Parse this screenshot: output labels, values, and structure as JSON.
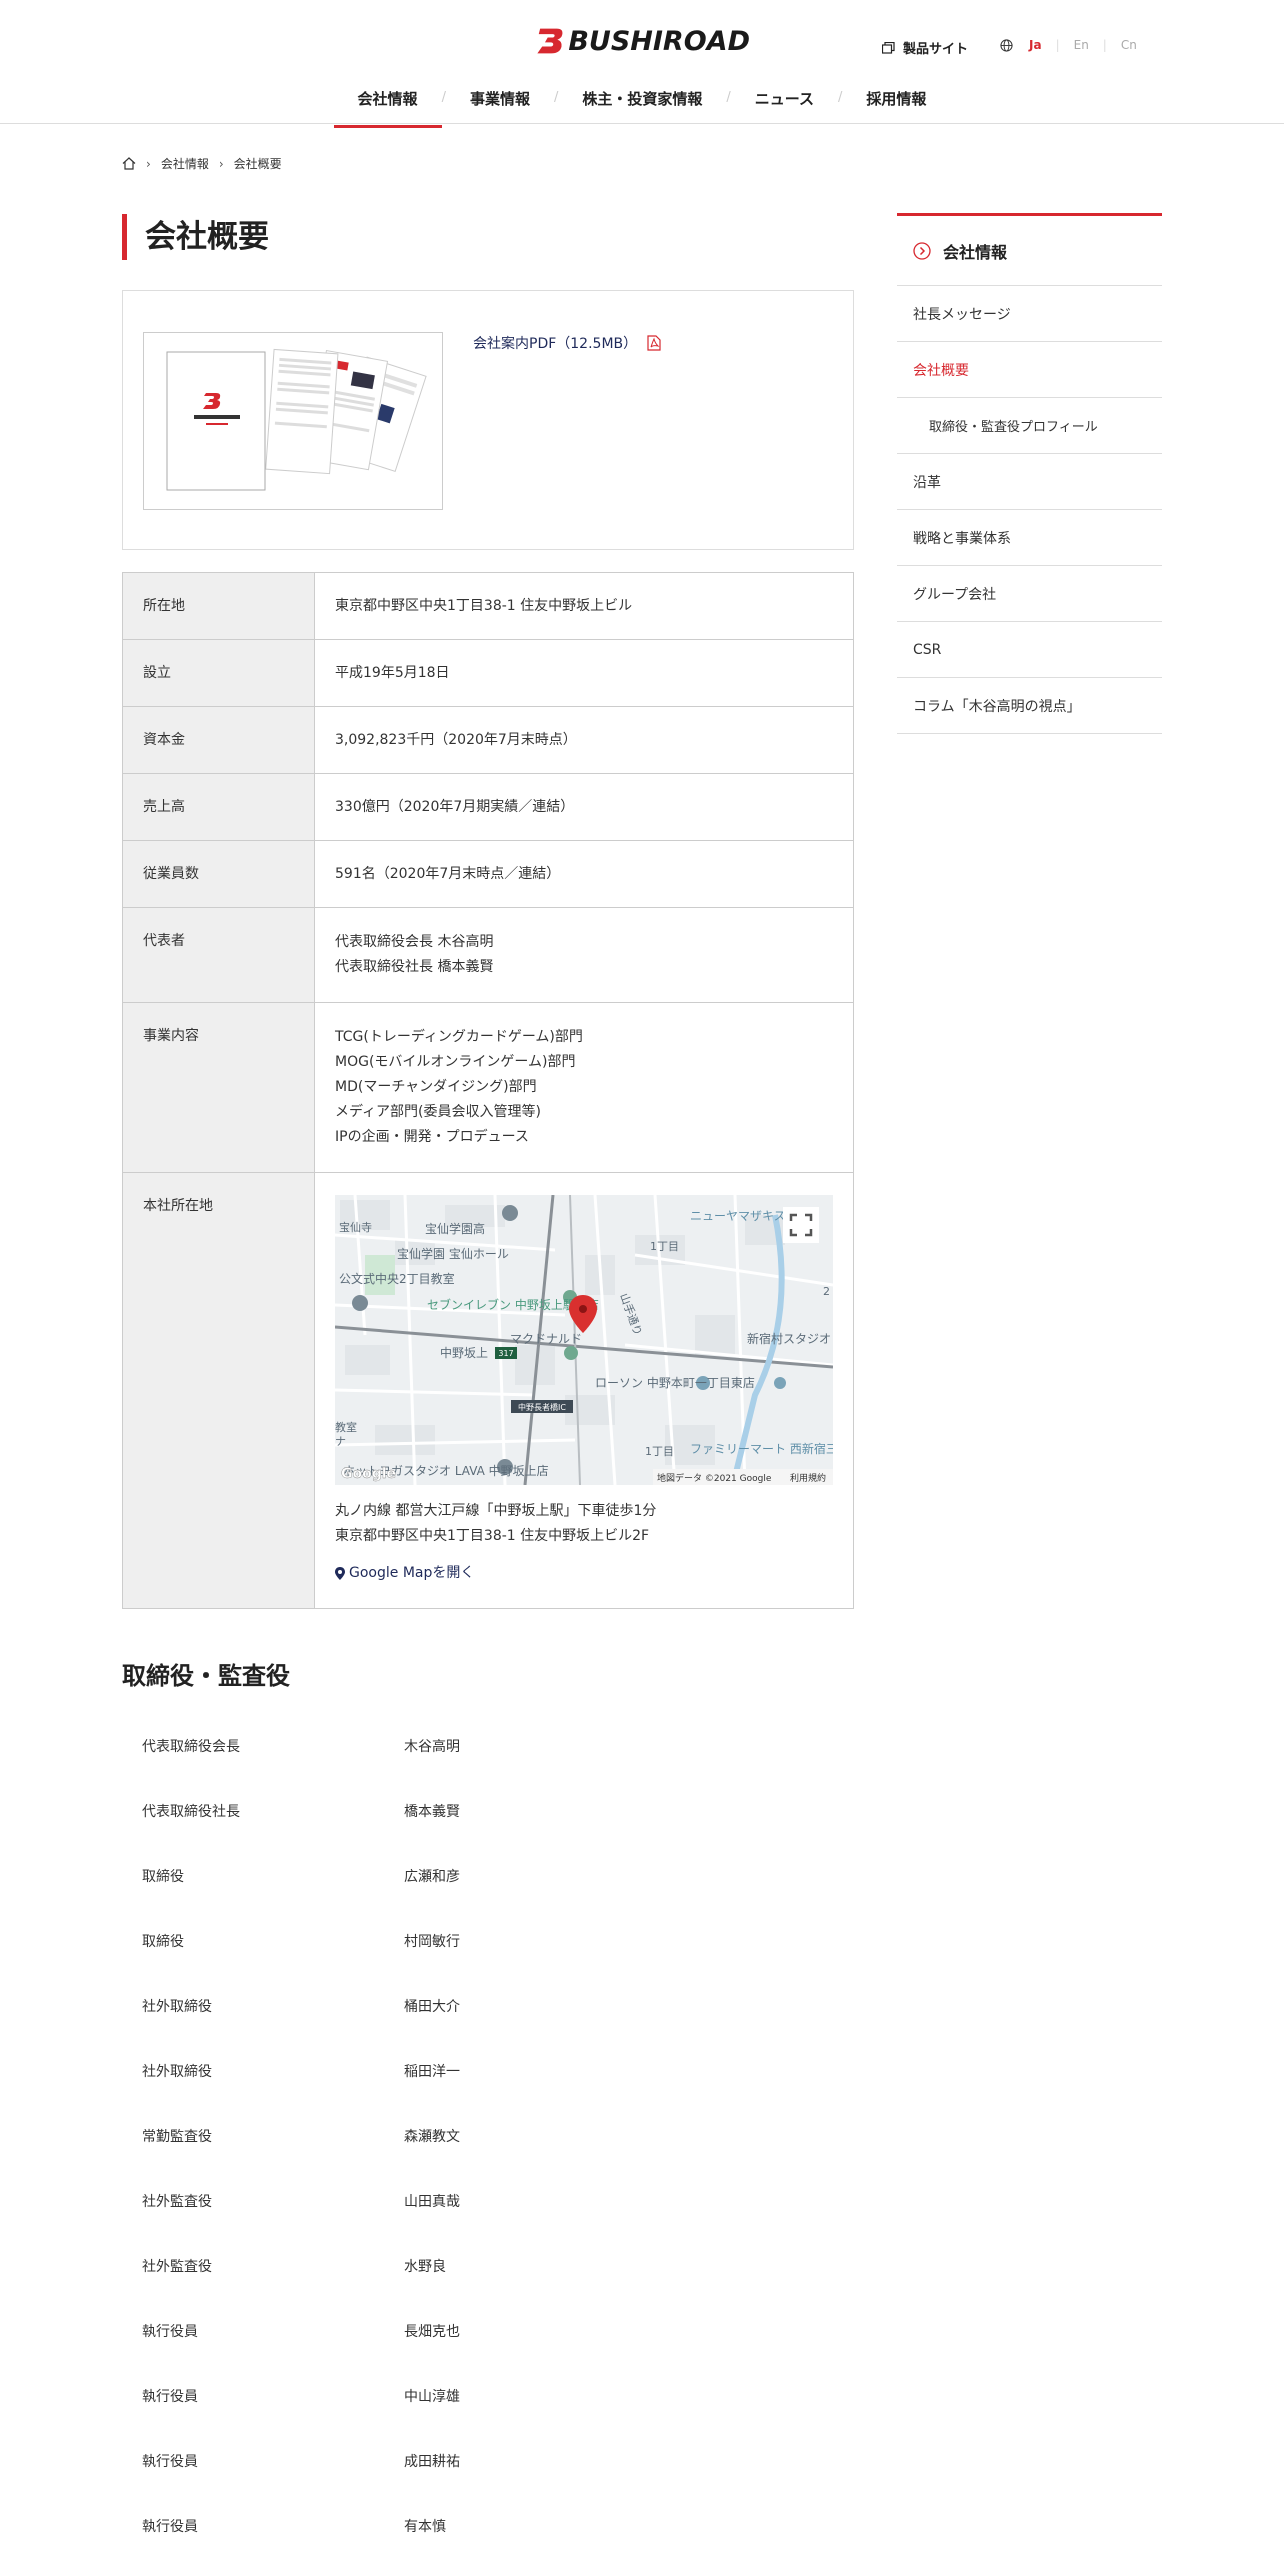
{
  "header": {
    "logo_text": "BUSHIROAD",
    "product_site": "製品サイト",
    "languages": [
      {
        "label": "Ja",
        "active": true
      },
      {
        "label": "En",
        "active": false
      },
      {
        "label": "Cn",
        "active": false
      }
    ],
    "nav": [
      "会社情報",
      "事業情報",
      "株主・投資家情報",
      "ニュース",
      "採用情報"
    ],
    "nav_active": "会社情報"
  },
  "breadcrumb": [
    "会社情報",
    "会社概要"
  ],
  "page_title": "会社概要",
  "pdf": {
    "link_text": "会社案内PDF（12.5MB）"
  },
  "info": {
    "rows": [
      {
        "label": "所在地",
        "lines": [
          "東京都中野区中央1丁目38-1 住友中野坂上ビル"
        ]
      },
      {
        "label": "設立",
        "lines": [
          "平成19年5月18日"
        ]
      },
      {
        "label": "資本金",
        "lines": [
          "3,092,823千円（2020年7月末時点）"
        ]
      },
      {
        "label": "売上高",
        "lines": [
          "330億円（2020年7月期実績／連結）"
        ]
      },
      {
        "label": "従業員数",
        "lines": [
          "591名（2020年7月末時点／連結）"
        ]
      },
      {
        "label": "代表者",
        "lines": [
          "代表取締役会長 木谷高明",
          "代表取締役社長 橋本義賢"
        ]
      },
      {
        "label": "事業内容",
        "lines": [
          "TCG(トレーディングカードゲーム)部門",
          "MOG(モバイルオンラインゲーム)部門",
          "MD(マーチャンダイジング)部門",
          "メディア部門(委員会収入管理等)",
          "IPの企画・開発・プロデュース"
        ]
      }
    ],
    "hq_label": "本社所在地",
    "map_labels": {
      "station": "中野坂上",
      "ic": "中野長者橋IC",
      "route": "317",
      "place1": "宝仙学園高",
      "place2": "宝仙学園 宝仙ホール",
      "place3": "公文式中央2丁目教室",
      "place4": "セブンイレブン 中野坂上駅西店",
      "place5": "マクドナルド",
      "place6": "ローソン 中野本町一丁目東店",
      "place7": "ホットヨガスタジオ LAVA 中野坂上店",
      "place8": "ファミリーマート 西新宿三井ビル店",
      "place9": "新宿村スタジオ",
      "place10": "ニューヤマザキストア",
      "place11": "宝仙寺",
      "road": "山手通り",
      "block1": "1丁目",
      "block2": "1丁目",
      "block3": "2",
      "edge1": "教室",
      "edge2": "ナ",
      "copyright": "地図データ ©2021 Google",
      "terms": "利用規約",
      "google": "Google"
    },
    "hq_caption": [
      "丸ノ内線 都営大江戸線「中野坂上駅」下車徒歩1分",
      "東京都中野区中央1丁目38-1 住友中野坂上ビル2F"
    ],
    "gmap_link": "Google Mapを開く"
  },
  "sidebar": {
    "heading": "会社情報",
    "items": [
      {
        "label": "社長メッセージ",
        "active": false,
        "sub": false
      },
      {
        "label": "会社概要",
        "active": true,
        "sub": false
      },
      {
        "label": "取締役・監査役プロフィール",
        "active": false,
        "sub": true
      },
      {
        "label": "沿革",
        "active": false,
        "sub": false
      },
      {
        "label": "戦略と事業体系",
        "active": false,
        "sub": false
      },
      {
        "label": "グループ会社",
        "active": false,
        "sub": false
      },
      {
        "label": "CSR",
        "active": false,
        "sub": false
      },
      {
        "label": "コラム「木谷高明の視点」",
        "active": false,
        "sub": false
      }
    ]
  },
  "officers": {
    "title": "取締役・監査役",
    "list": [
      {
        "role": "代表取締役会長",
        "name": "木谷高明"
      },
      {
        "role": "代表取締役社長",
        "name": "橋本義賢"
      },
      {
        "role": "取締役",
        "name": "広瀬和彦"
      },
      {
        "role": "取締役",
        "name": "村岡敏行"
      },
      {
        "role": "社外取締役",
        "name": "桶田大介"
      },
      {
        "role": "社外取締役",
        "name": "稲田洋一"
      },
      {
        "role": "常勤監査役",
        "name": "森瀬教文"
      },
      {
        "role": "社外監査役",
        "name": "山田真哉"
      },
      {
        "role": "社外監査役",
        "name": "水野良"
      },
      {
        "role": "執行役員",
        "name": "長畑克也"
      },
      {
        "role": "執行役員",
        "name": "中山淳雄"
      },
      {
        "role": "執行役員",
        "name": "成田耕祐"
      },
      {
        "role": "執行役員",
        "name": "有本慎"
      }
    ]
  },
  "colors": {
    "accent": "#d7282f",
    "link": "#1f2a5a",
    "table_head_bg": "#efefef"
  }
}
